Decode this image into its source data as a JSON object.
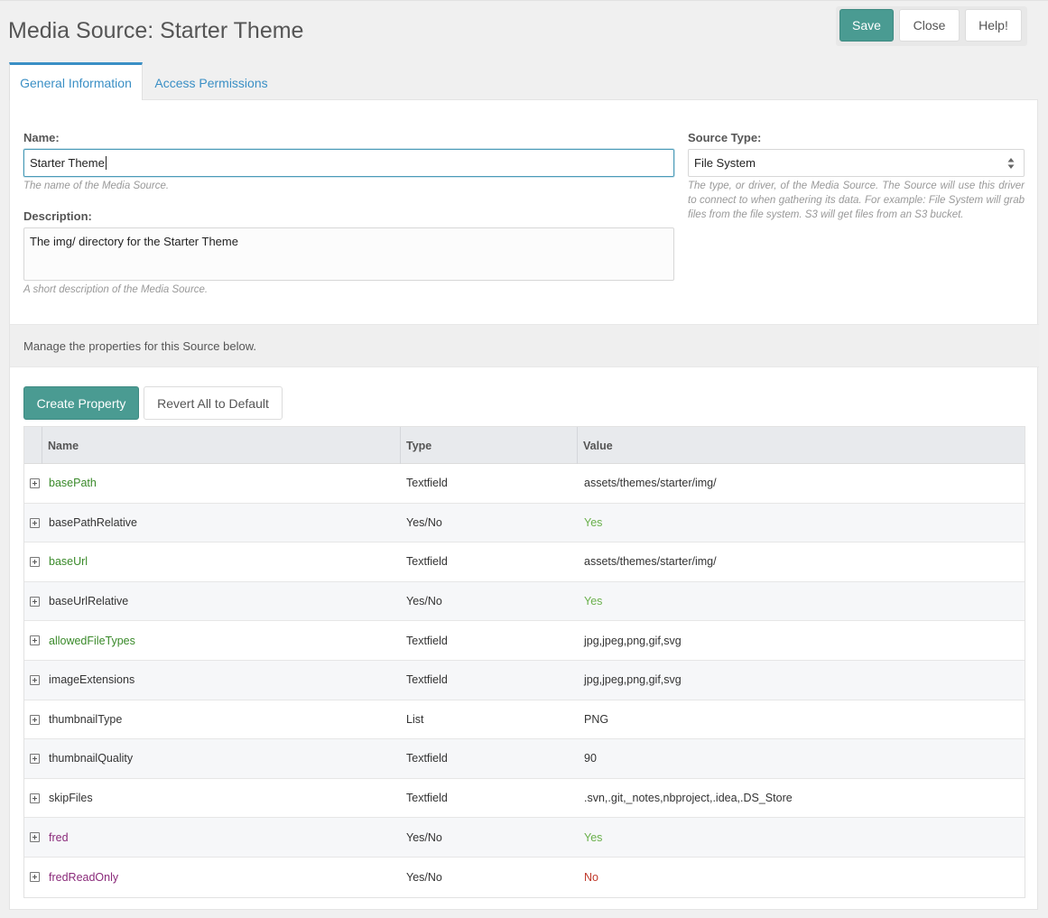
{
  "page": {
    "title": "Media Source: Starter Theme"
  },
  "actions": {
    "save": "Save",
    "close": "Close",
    "help": "Help!"
  },
  "tabs": [
    {
      "label": "General Information",
      "active": true
    },
    {
      "label": "Access Permissions",
      "active": false
    }
  ],
  "form": {
    "name_label": "Name:",
    "name_value": "Starter Theme",
    "name_help": "The name of the Media Source.",
    "description_label": "Description:",
    "description_value": "The img/ directory for the Starter Theme",
    "description_help": "A short description of the Media Source.",
    "source_type_label": "Source Type:",
    "source_type_value": "File System",
    "source_type_help": "The type, or driver, of the Media Source. The Source will use this driver to connect to when gathering its data. For example: File System will grab files from the file system. S3 will get files from an S3 bucket."
  },
  "properties": {
    "intro": "Manage the properties for this Source below.",
    "create_button": "Create Property",
    "revert_button": "Revert All to Default",
    "columns": {
      "name": "Name",
      "type": "Type",
      "value": "Value"
    },
    "rows": [
      {
        "name": "basePath",
        "type": "Textfield",
        "value": "assets/themes/starter/img/",
        "name_color": "#3a8a2a",
        "value_color": "#333333"
      },
      {
        "name": "basePathRelative",
        "type": "Yes/No",
        "value": "Yes",
        "name_color": "#333333",
        "value_color": "#6ab04c"
      },
      {
        "name": "baseUrl",
        "type": "Textfield",
        "value": "assets/themes/starter/img/",
        "name_color": "#3a8a2a",
        "value_color": "#333333"
      },
      {
        "name": "baseUrlRelative",
        "type": "Yes/No",
        "value": "Yes",
        "name_color": "#333333",
        "value_color": "#6ab04c"
      },
      {
        "name": "allowedFileTypes",
        "type": "Textfield",
        "value": "jpg,jpeg,png,gif,svg",
        "name_color": "#3a8a2a",
        "value_color": "#333333"
      },
      {
        "name": "imageExtensions",
        "type": "Textfield",
        "value": "jpg,jpeg,png,gif,svg",
        "name_color": "#333333",
        "value_color": "#333333"
      },
      {
        "name": "thumbnailType",
        "type": "List",
        "value": "PNG",
        "name_color": "#333333",
        "value_color": "#333333"
      },
      {
        "name": "thumbnailQuality",
        "type": "Textfield",
        "value": "90",
        "name_color": "#333333",
        "value_color": "#333333"
      },
      {
        "name": "skipFiles",
        "type": "Textfield",
        "value": ".svn,.git,_notes,nbproject,.idea,.DS_Store",
        "name_color": "#333333",
        "value_color": "#333333"
      },
      {
        "name": "fred",
        "type": "Yes/No",
        "value": "Yes",
        "name_color": "#8a2a7a",
        "value_color": "#6ab04c"
      },
      {
        "name": "fredReadOnly",
        "type": "Yes/No",
        "value": "No",
        "name_color": "#8a2a7a",
        "value_color": "#c0392b"
      }
    ]
  },
  "colors": {
    "accent": "#4a9b92",
    "link": "#3a8fc5"
  },
  "icons": {
    "expander": "plus-square-icon",
    "select": "sort-arrows-icon"
  }
}
